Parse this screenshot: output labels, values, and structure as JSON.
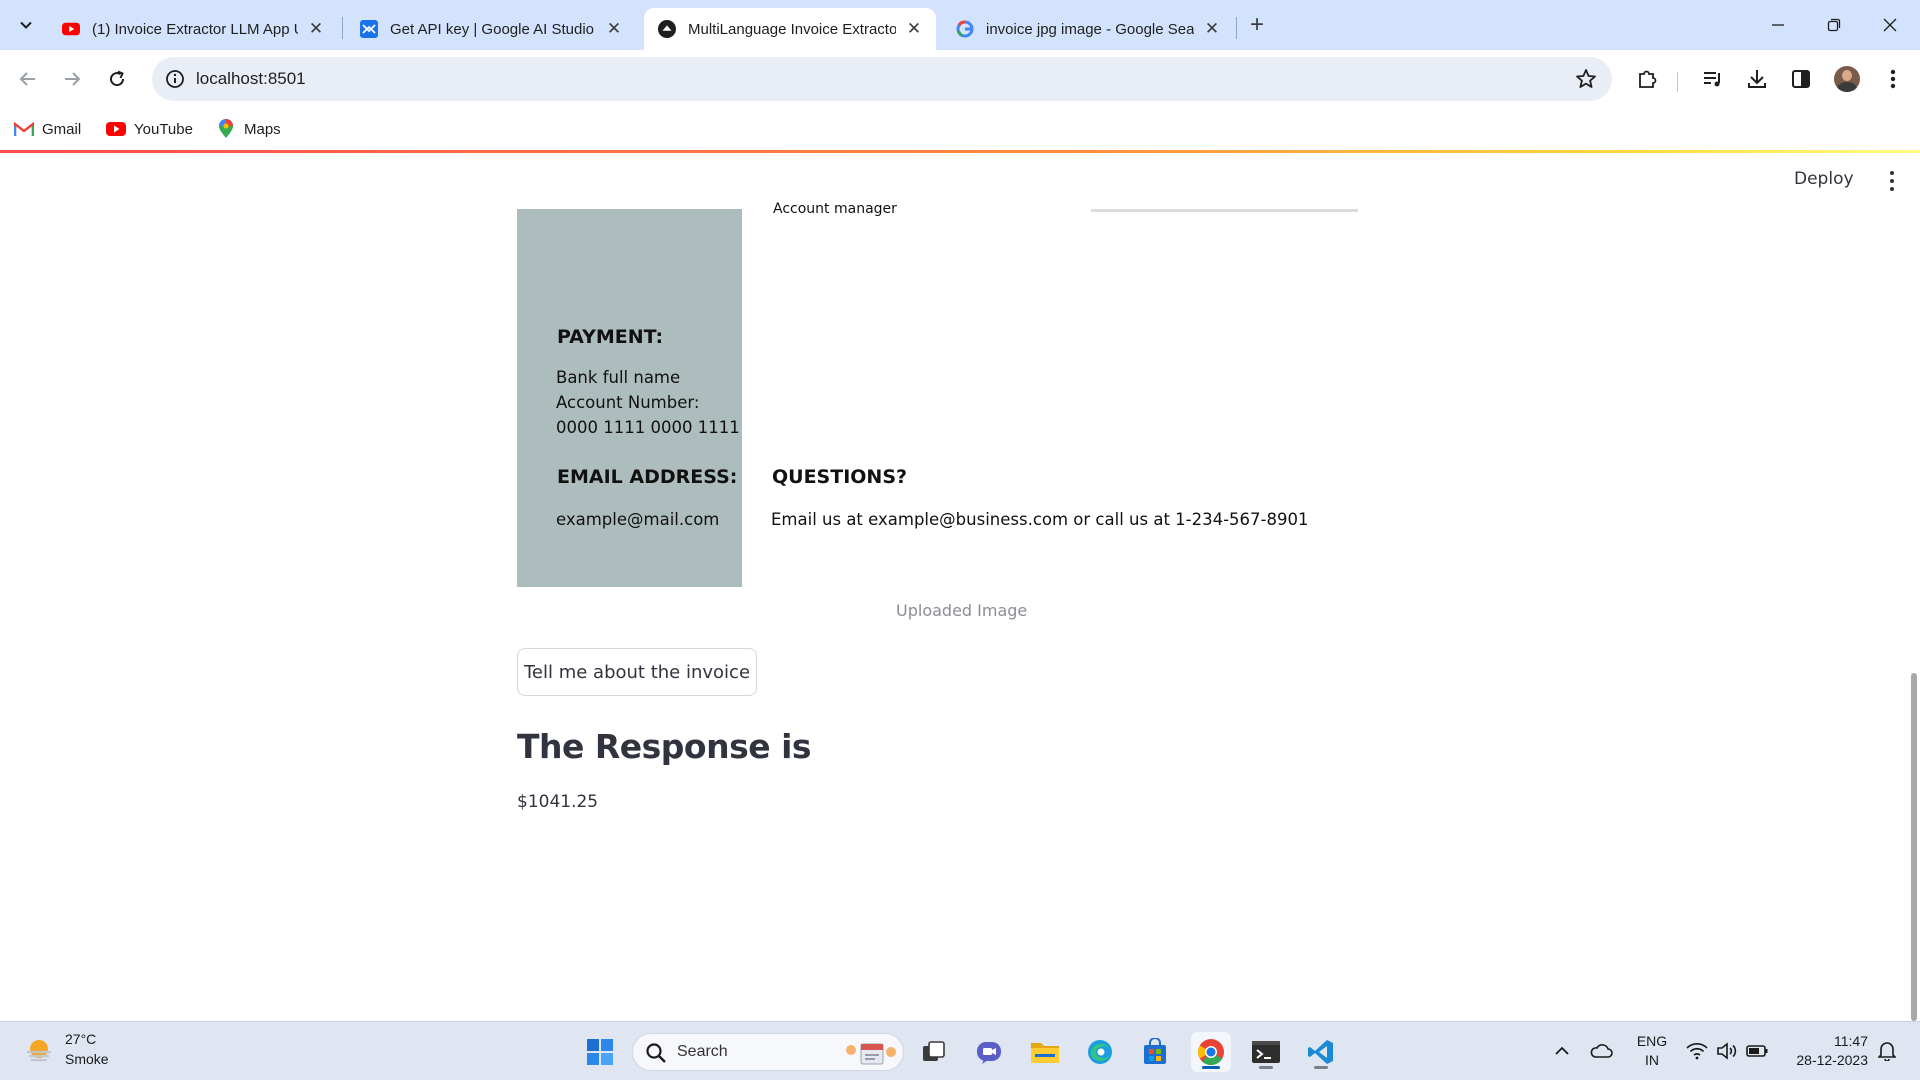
{
  "browser": {
    "tabs": [
      {
        "title": "(1) Invoice Extractor LLM App U",
        "favicon": "youtube-icon"
      },
      {
        "title": "Get API key | Google AI Studio",
        "favicon": "ai-studio-icon"
      },
      {
        "title": "MultiLanguage Invoice Extracto",
        "favicon": "streamlit-icon"
      },
      {
        "title": "invoice jpg image - Google Sea",
        "favicon": "google-icon"
      }
    ],
    "url": "localhost:8501",
    "bookmarks": [
      {
        "label": "Gmail",
        "icon": "gmail-icon"
      },
      {
        "label": "YouTube",
        "icon": "youtube-icon"
      },
      {
        "label": "Maps",
        "icon": "maps-icon"
      }
    ]
  },
  "app": {
    "deploy_label": "Deploy",
    "invoice": {
      "cut_text": "Account manager",
      "payment_heading": "PAYMENT:",
      "payment_lines": [
        "Bank full name",
        "Account Number:",
        "0000 1111 0000 1111"
      ],
      "email_heading": "EMAIL ADDRESS:",
      "email_value": "example@mail.com",
      "questions_heading": "QUESTIONS?",
      "questions_text": "Email us at example@business.com or call us at 1-234-567-8901",
      "side_color": "#adbcbc"
    },
    "caption": "Uploaded Image",
    "button_label": "Tell me about the invoice",
    "response_heading": "The Response is",
    "response_value": "$1041.25",
    "accent_color": "#ff4b4b"
  },
  "taskbar": {
    "weather_temp": "27°C",
    "weather_desc": "Smoke",
    "search_placeholder": "Search",
    "lang_1": "ENG",
    "lang_2": "IN",
    "time": "11:47",
    "date": "28-12-2023"
  }
}
